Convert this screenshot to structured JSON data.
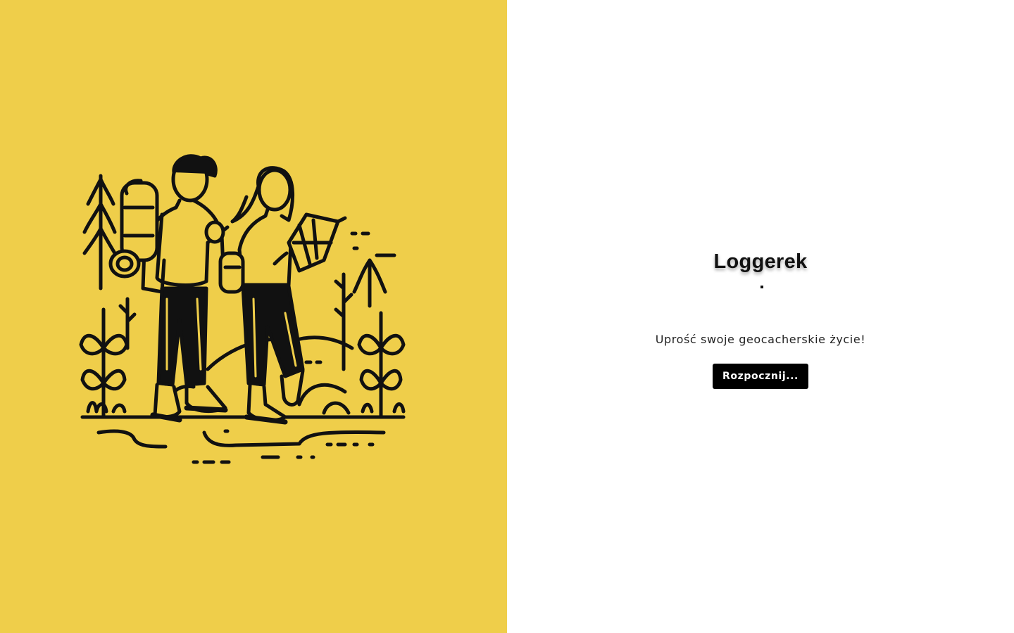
{
  "app": {
    "title": "Loggerek",
    "tagline": "Uprość swoje geocacherskie życie!",
    "start_button_label": "Rozpocznij..."
  },
  "illustration": {
    "subject": "hikers-with-map-illustration"
  },
  "colors": {
    "accent_yellow": "#efce4a",
    "button_bg": "#000000",
    "button_text": "#ffffff",
    "line_art": "#111111"
  }
}
